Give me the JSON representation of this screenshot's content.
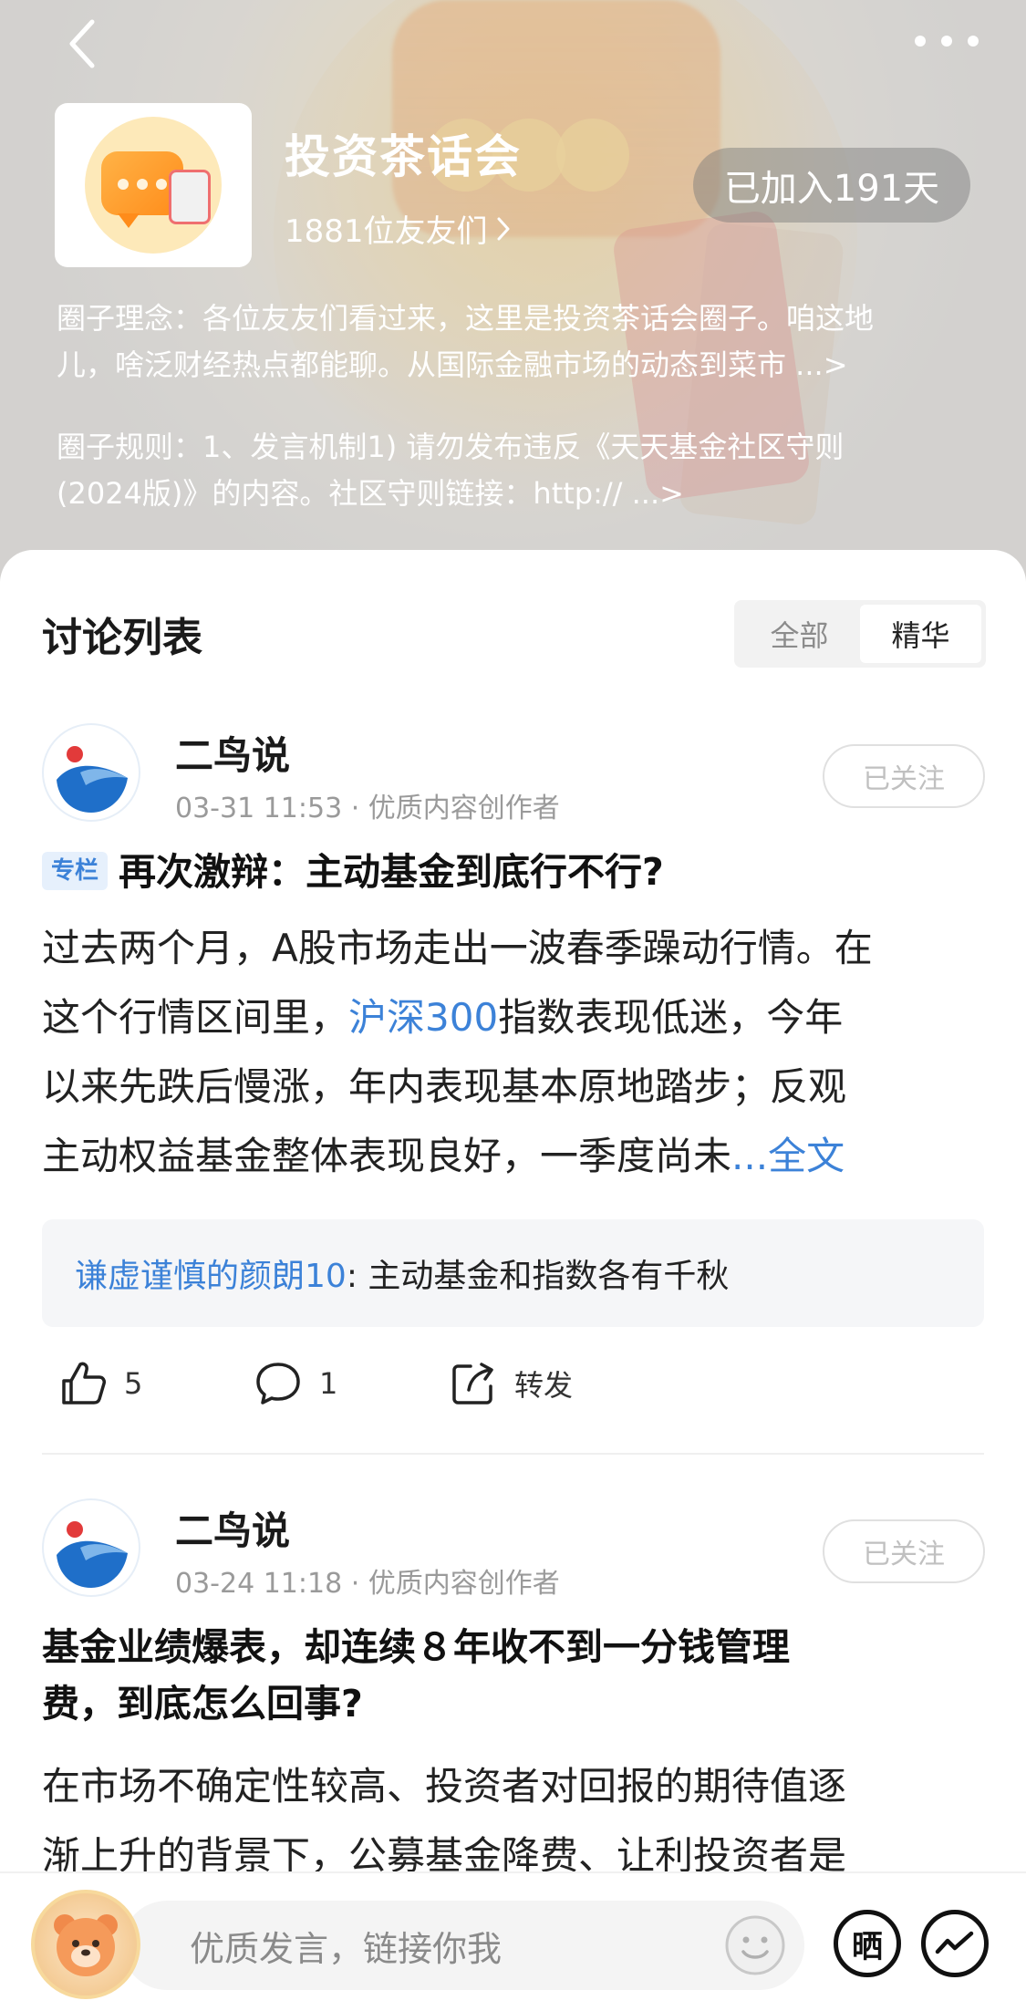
{
  "header": {
    "back_icon": "chevron-left-icon",
    "more_icon": "more-dots-icon",
    "group_name": "投资茶话会",
    "member_count_text": "1881位友友们",
    "joined_badge": "已加入191天",
    "philosophy_line1": "圈子理念：各位友友们看过来，这里是投资茶话会圈子。咱这地",
    "philosophy_line2": "儿，啥泛财经热点都能聊。从国际金融市场的动态到菜市 ...>",
    "rules_line1": "圈子规则：1、发言机制1) 请勿发布违反《天天基金社区守则",
    "rules_line2": "(2024版)》的内容。社区守则链接：http:// ...>"
  },
  "discussion": {
    "title": "讨论列表",
    "tabs": [
      "全部",
      "精华"
    ],
    "active_tab": "精华"
  },
  "posts": [
    {
      "author": "二鸟说",
      "meta": "03-31 11:53 · 优质内容创作者",
      "follow_label": "已关注",
      "tag": "专栏",
      "title": "再次激辩：主动基金到底行不行?",
      "body_line1": "过去两个月，A股市场走出一波春季躁动行情。在",
      "body_line2_pre": "这个行情区间里，",
      "body_line2_link": "沪深300",
      "body_line2_post": "指数表现低迷，今年",
      "body_line3": "以来先跌后慢涨，年内表现基本原地踏步；反观",
      "body_line4": "主动权益基金整体表现良好，一季度尚未",
      "more_label": "...全文",
      "comment_user": "谦虚谨慎的颜朗10",
      "comment_text": ": 主动基金和指数各有千秋",
      "likes": "5",
      "comments": "1",
      "share_label": "转发"
    },
    {
      "author": "二鸟说",
      "meta": "03-24 11:18 · 优质内容创作者",
      "follow_label": "已关注",
      "title_line1": "基金业绩爆表，却连续８年收不到一分钱管理",
      "title_line2": "费，到底怎么回事?",
      "body_line1": "在市场不确定性较高、投资者对回报的期待值逐",
      "body_line2": "渐上升的背景下，公募基金降费、让利投资者是"
    }
  ],
  "bottom_bar": {
    "compose_placeholder": "优质发言，链接你我",
    "sun_label": "晒"
  },
  "colors": {
    "accent_blue": "#3c82d8",
    "tag_bg": "#e6f0fc",
    "badge_bg": "rgba(120,120,120,0.45)"
  }
}
